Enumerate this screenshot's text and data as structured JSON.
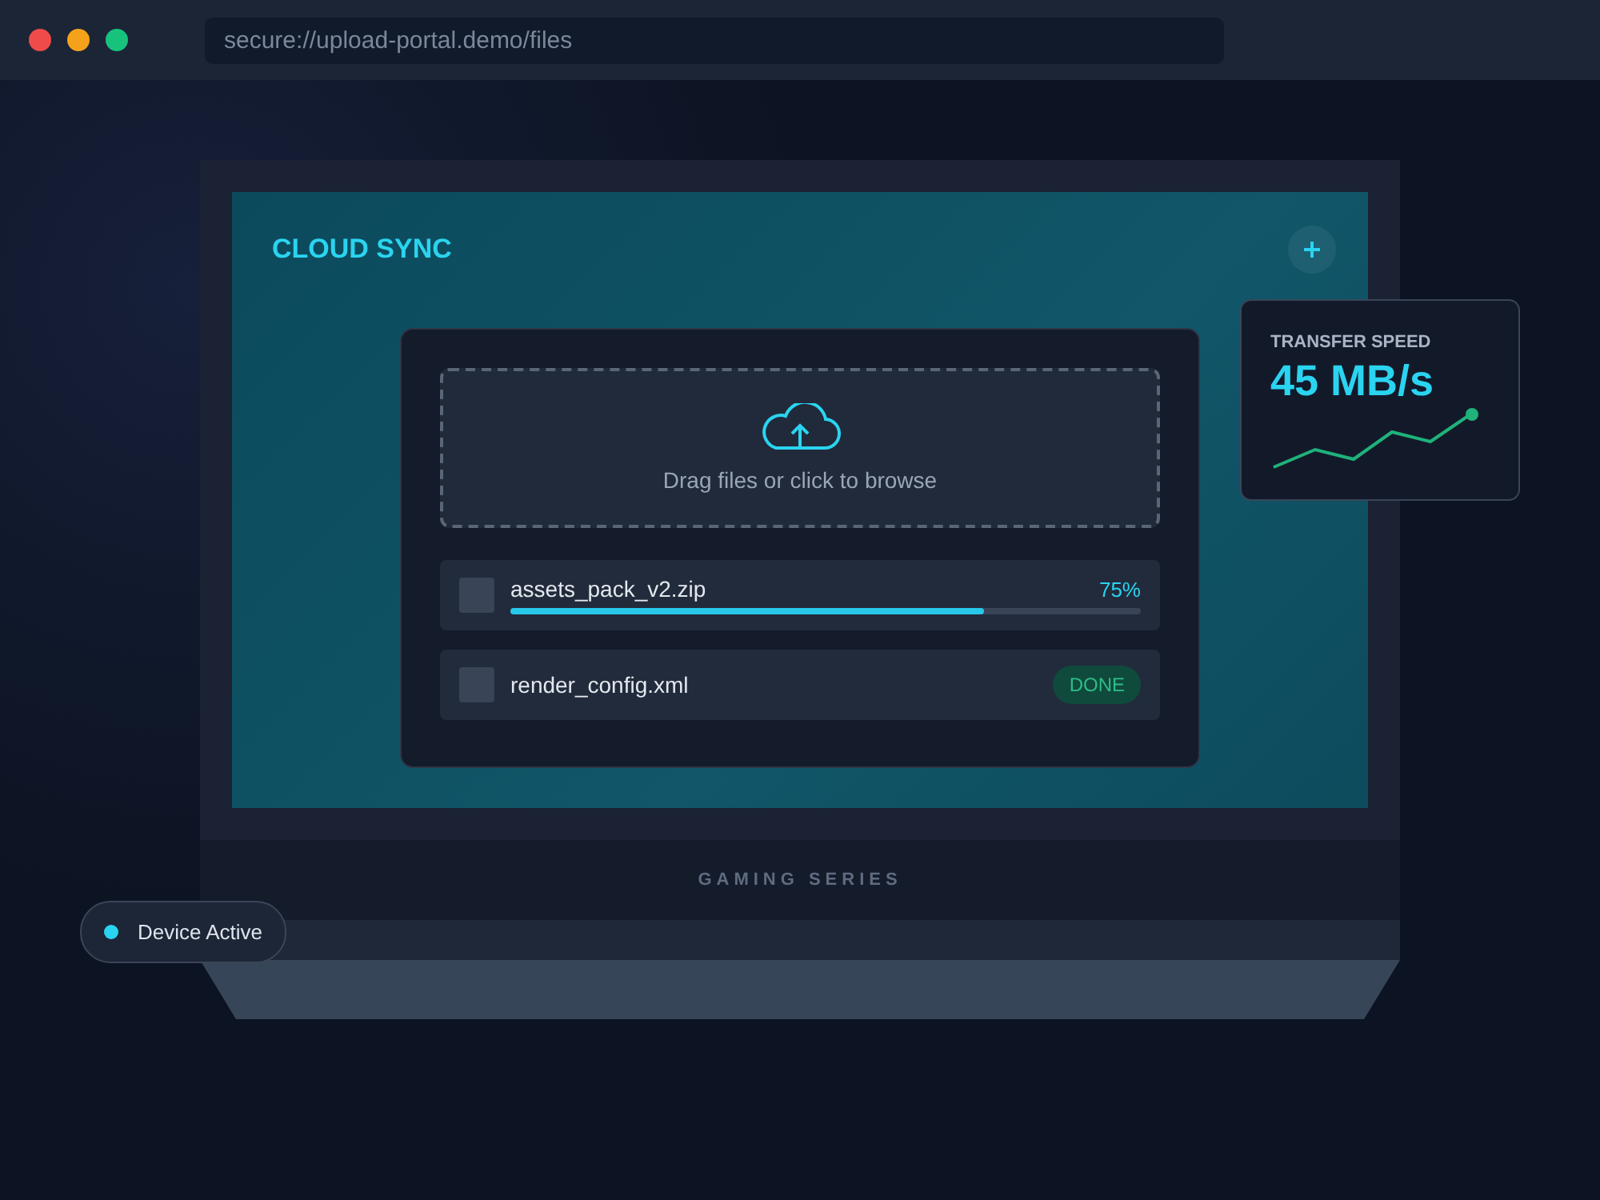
{
  "browser": {
    "url": "secure://upload-portal.demo/files"
  },
  "app": {
    "title": "CLOUD SYNC"
  },
  "dropzone": {
    "text": "Drag files or click to browse"
  },
  "files": [
    {
      "name": "assets_pack_v2.zip",
      "kind": "progress",
      "reading": "75%",
      "level": 0.75
    },
    {
      "name": "render_config.xml",
      "kind": "done",
      "badge": "DONE"
    }
  ],
  "speed": {
    "label": "TRANSFER SPEED",
    "value": "45 MB/s"
  },
  "laptop": {
    "brand": "GAMING SERIES"
  },
  "status": {
    "label": "Device Active"
  }
}
